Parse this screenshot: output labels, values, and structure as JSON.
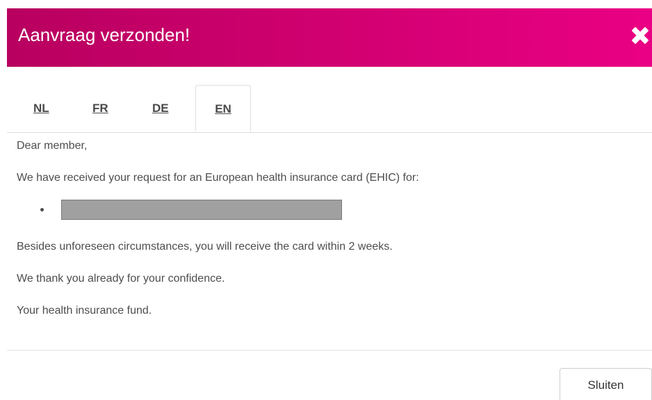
{
  "header": {
    "title": "Aanvraag verzonden!",
    "close_icon": "close-icon",
    "background_start": "#b8005f",
    "background_end": "#ea0084"
  },
  "tabs": [
    {
      "label": "NL",
      "active": false
    },
    {
      "label": "FR",
      "active": false
    },
    {
      "label": "DE",
      "active": false
    },
    {
      "label": "EN",
      "active": true
    }
  ],
  "body": {
    "greeting": "Dear member,",
    "intro": "We have received your request for an European health insurance card (EHIC) for:",
    "list_items": [
      "[redacted]"
    ],
    "delivery": "Besides unforeseen circumstances, you will receive the card within 2 weeks.",
    "thanks": "We thank you already for your confidence.",
    "signature": "Your health insurance fund."
  },
  "footer": {
    "close_label": "Sluiten"
  }
}
